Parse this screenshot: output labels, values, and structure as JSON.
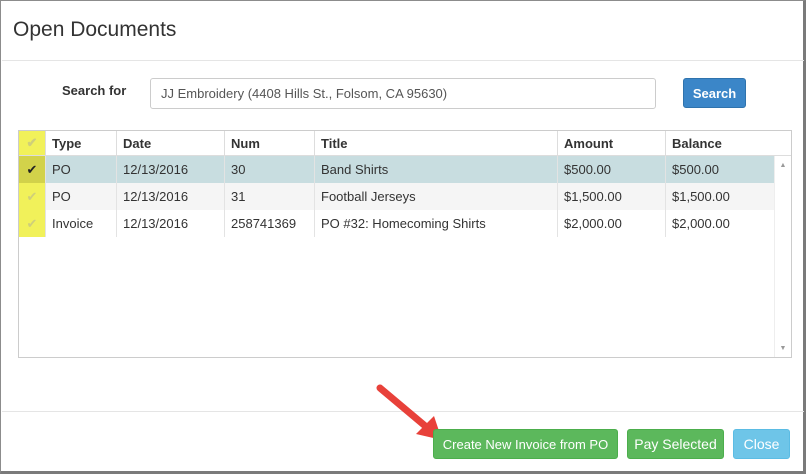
{
  "dialog": {
    "title": "Open Documents"
  },
  "search": {
    "label": "Search for",
    "value": "JJ Embroidery (4408 Hills St., Folsom, CA 95630)",
    "button_label": "Search"
  },
  "table": {
    "columns": [
      "Type",
      "Date",
      "Num",
      "Title",
      "Amount",
      "Balance"
    ],
    "rows": [
      {
        "checked": true,
        "type": "PO",
        "date": "12/13/2016",
        "num": "30",
        "title": "Band Shirts",
        "amount": "$500.00",
        "balance": "$500.00"
      },
      {
        "checked": false,
        "type": "PO",
        "date": "12/13/2016",
        "num": "31",
        "title": "Football Jerseys",
        "amount": "$1,500.00",
        "balance": "$1,500.00"
      },
      {
        "checked": false,
        "type": "Invoice",
        "date": "12/13/2016",
        "num": "258741369",
        "title": "PO #32: Homecoming Shirts",
        "amount": "$2,000.00",
        "balance": "$2,000.00"
      }
    ]
  },
  "footer": {
    "create_label": "Create New Invoice from PO",
    "pay_label": "Pay Selected",
    "close_label": "Close"
  },
  "icons": {
    "check": "check-icon",
    "arrow": "red-arrow-icon",
    "scroll_up": "scroll-up-icon",
    "scroll_down": "scroll-down-icon"
  },
  "colors": {
    "primary": "#3b86c8",
    "success": "#5cb85c",
    "info": "#6ec5e8",
    "highlight": "#f1f15a",
    "selected_row": "#c8dde0",
    "arrow": "#e8413a"
  }
}
